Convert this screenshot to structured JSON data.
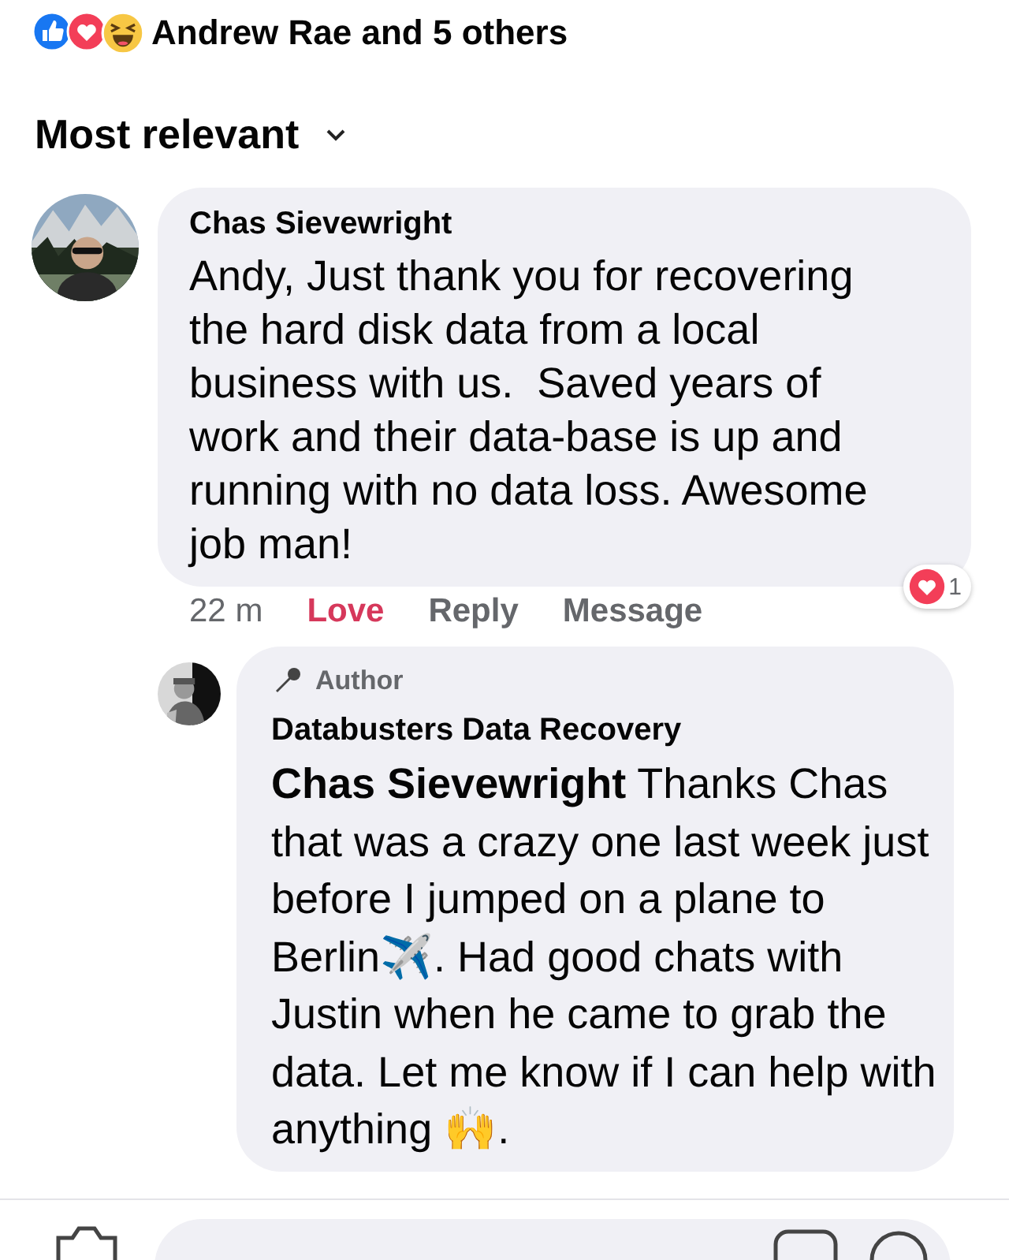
{
  "reactions": {
    "summary": "Andrew Rae and 5 others"
  },
  "sort": {
    "label": "Most relevant"
  },
  "comments": [
    {
      "kind": "comment",
      "author": "Chas Sievewright",
      "body": "Andy, Just thank you for recovering the hard disk data from a local business with us.  Saved years of work and their data-base is up and running with no data loss. Awesome job man!",
      "time": "22 m",
      "actions": [
        {
          "label": "Love",
          "selected": true
        },
        {
          "label": "Reply",
          "selected": false
        },
        {
          "label": "Message",
          "selected": false
        }
      ],
      "reaction_count": "1"
    },
    {
      "kind": "reply",
      "badge": "Author",
      "author": "Databusters Data Recovery",
      "body": "**Chas Sievewright** Thanks Chas that was a crazy one last week just before I jumped on a plane to Berlin✈️. Had good chats with Justin when he came to grab the data. Let me know if I can help with anything 🙌."
    }
  ]
}
